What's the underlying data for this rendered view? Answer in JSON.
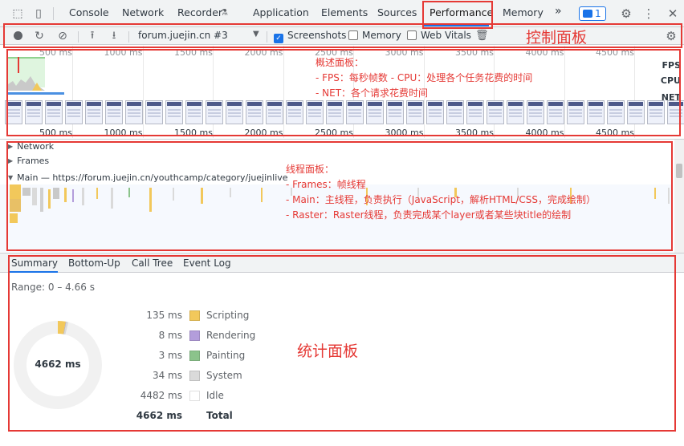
{
  "tabs": [
    "Console",
    "Network",
    "Recorder",
    "Application",
    "Elements",
    "Sources",
    "Performance",
    "Memory"
  ],
  "active_tab": "Performance",
  "more_tabs": "»",
  "issues_count": "1",
  "controls": {
    "target": "forum.juejin.cn #3",
    "screenshots_label": "Screenshots",
    "memory_label": "Memory",
    "web_vitals_label": "Web Vitals",
    "screenshots_checked": true
  },
  "overview": {
    "ticks": [
      "500 ms",
      "1000 ms",
      "1500 ms",
      "2000 ms",
      "2500 ms",
      "3000 ms",
      "3500 ms",
      "4000 ms",
      "4500 ms"
    ],
    "tracks": [
      "FPS",
      "CPU",
      "NET"
    ]
  },
  "threads": {
    "network": "Network",
    "frames": "Frames",
    "main": "Main — https://forum.juejin.cn/youthcamp/category/juejinlive"
  },
  "summary": {
    "tabs": [
      "Summary",
      "Bottom-Up",
      "Call Tree",
      "Event Log"
    ],
    "range": "Range: 0 – 4.66 s",
    "total_label": "4662 ms",
    "rows": [
      {
        "value": "135 ms",
        "name": "Scripting",
        "color": "#f2c85b"
      },
      {
        "value": "8 ms",
        "name": "Rendering",
        "color": "#b39ddb"
      },
      {
        "value": "3 ms",
        "name": "Painting",
        "color": "#8bc38b"
      },
      {
        "value": "34 ms",
        "name": "System",
        "color": "#dadada"
      },
      {
        "value": "4482 ms",
        "name": "Idle",
        "color": "#ffffff"
      },
      {
        "value": "4662 ms",
        "name": "Total",
        "color": ""
      }
    ]
  },
  "annotations": {
    "control": "控制面板",
    "overview": [
      "概述面板：",
      "- FPS：每秒帧数      - CPU：处理各个任务花费的时间",
      "- NET：各个请求花费时间"
    ],
    "threads": [
      "线程面板：",
      "- Frames：帧线程",
      "- Main：主线程，负责执行（JavaScript，解析HTML/CSS，完成绘制）",
      "- Raster：Raster线程，负责完成某个layer或者某些块title的绘制"
    ],
    "summary": "统计面板"
  }
}
